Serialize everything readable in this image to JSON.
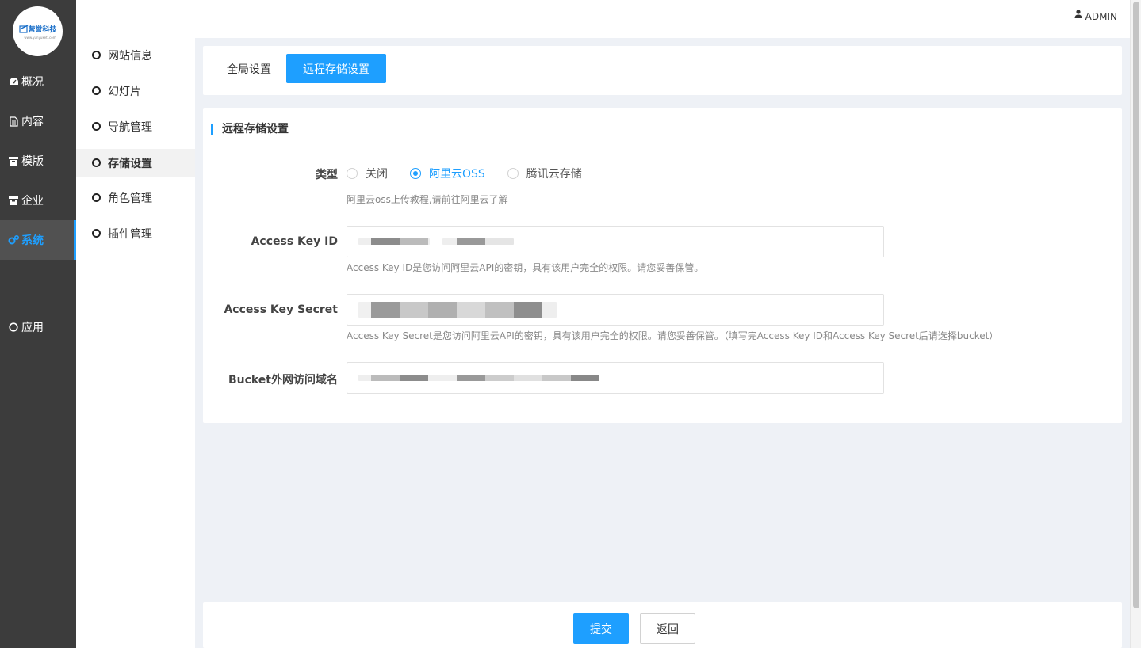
{
  "logo": {
    "text": "营誉科技",
    "sub": "www.yunyuketi.com"
  },
  "sidebar": {
    "items": [
      {
        "label": "概况",
        "icon": "dashboard-icon"
      },
      {
        "label": "内容",
        "icon": "document-icon"
      },
      {
        "label": "模版",
        "icon": "archive-icon"
      },
      {
        "label": "企业",
        "icon": "archive-icon"
      },
      {
        "label": "系统",
        "icon": "cogs-icon",
        "active": true
      },
      {
        "label": "应用",
        "icon": "circle-icon"
      }
    ]
  },
  "header": {
    "user": "ADMIN"
  },
  "subnav": {
    "items": [
      {
        "label": "网站信息"
      },
      {
        "label": "幻灯片"
      },
      {
        "label": "导航管理"
      },
      {
        "label": "存储设置",
        "active": true
      },
      {
        "label": "角色管理"
      },
      {
        "label": "插件管理"
      }
    ]
  },
  "tabs": [
    {
      "label": "全局设置"
    },
    {
      "label": "远程存储设置",
      "active": true
    }
  ],
  "form": {
    "section_title": "远程存储设置",
    "type_label": "类型",
    "type_options": [
      {
        "label": "关闭",
        "checked": false
      },
      {
        "label": "阿里云OSS",
        "checked": true
      },
      {
        "label": "腾讯云存储",
        "checked": false
      }
    ],
    "type_hint": "阿里云oss上传教程,请前往阿里云了解",
    "access_key_id_label": "Access Key ID",
    "access_key_id_hint": "Access Key ID是您访问阿里云API的密钥，具有该用户完全的权限。请您妥善保管。",
    "access_key_secret_label": "Access Key Secret",
    "access_key_secret_hint": "Access Key Secret是您访问阿里云API的密钥，具有该用户完全的权限。请您妥善保管。（填写完Access Key ID和Access Key Secret后请选择bucket）",
    "bucket_label": "Bucket外网访问域名"
  },
  "buttons": {
    "submit": "提交",
    "back": "返回"
  },
  "colors": {
    "accent": "#1e9fff",
    "sidebar_bg": "#3c3c3c",
    "page_bg": "#eef1f6"
  }
}
